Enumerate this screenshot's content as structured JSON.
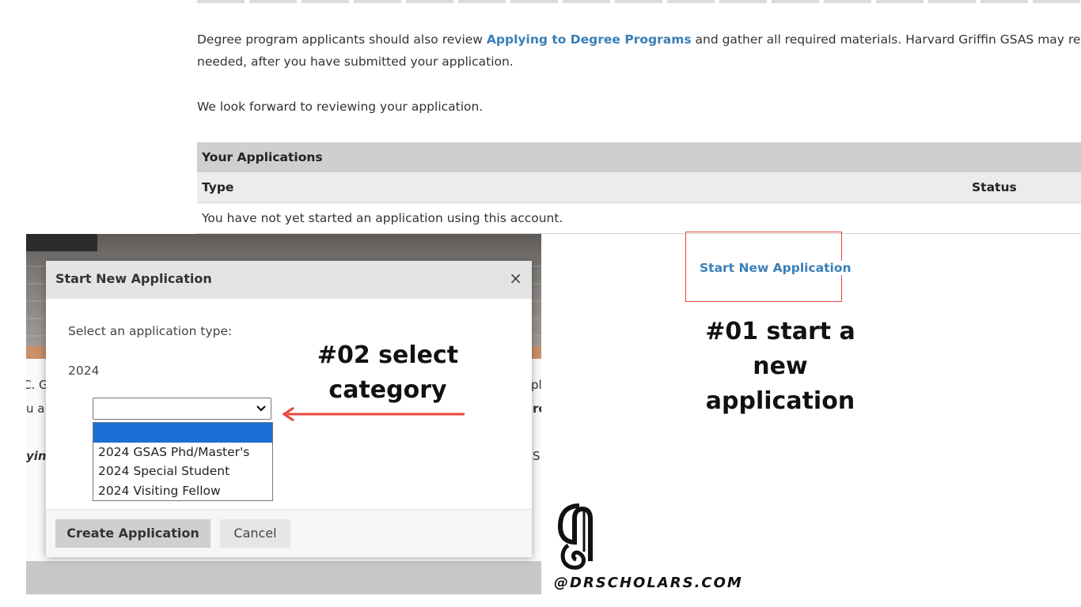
{
  "intro": {
    "p1_before": "Degree program applicants should also review ",
    "p1_link": "Applying to Degree Programs",
    "p1_after": " and gather all required materials. Harvard Griffin GSAS may reque",
    "p1_line2": "needed, after you have submitted your application.",
    "p2": "We look forward to reviewing your application."
  },
  "applications": {
    "header": "Your Applications",
    "col_type": "Type",
    "col_status": "Status",
    "empty": "You have not yet started an application using this account."
  },
  "start_link": "Start New Application",
  "annotations": {
    "step1_line1": "#01 start a new",
    "step1_line2": "application",
    "step2_line1": "#02 select",
    "step2_line2": "category"
  },
  "background_peek": {
    "left1": "C. G",
    "left2": "u a",
    "left3": "yin",
    "right1": "pl",
    "right2": "rc",
    "right3": "S"
  },
  "modal": {
    "title": "Start New Application",
    "close_glyph": "×",
    "label": "Select an application type:",
    "year": "2024",
    "select_value": "",
    "options": [
      "",
      "2024 GSAS Phd/Master's",
      "2024 Special Student",
      "2024 Visiting Fellow"
    ],
    "create_label": "Create Application",
    "cancel_label": "Cancel"
  },
  "brand": {
    "handle": "@DRSCHOLARS.COM"
  },
  "colors": {
    "link": "#3a7fb8",
    "annotation_red": "#e8453c",
    "dropdown_highlight": "#1a6fd6"
  },
  "icons": {
    "close": "close-icon",
    "chevron": "chevron-down-icon",
    "arrow": "arrow-left-icon"
  }
}
